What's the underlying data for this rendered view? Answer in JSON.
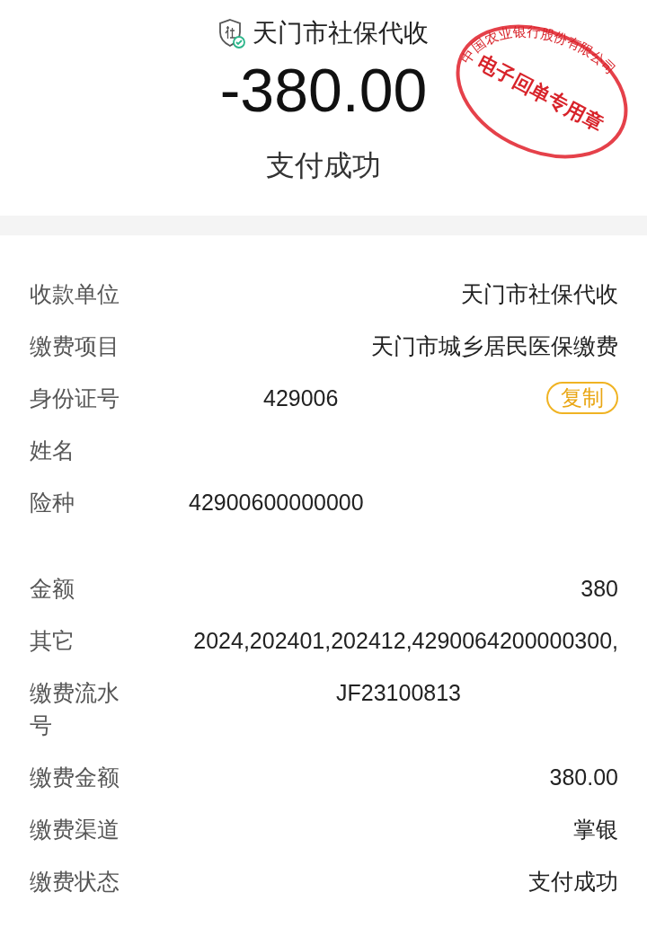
{
  "header": {
    "payee": "天门市社保代收",
    "amount": "-380.00",
    "status": "支付成功"
  },
  "stamp": {
    "ring_text": "中国农业银行股份有限公司",
    "center_text": "电子回单专用章"
  },
  "details": [
    {
      "label": "收款单位",
      "value": "天门市社保代收",
      "kind": "plain"
    },
    {
      "label": "缴费项目",
      "value": "天门市城乡居民医保缴费",
      "kind": "plain"
    },
    {
      "label": "身份证号",
      "value": "429006",
      "kind": "copy",
      "button": "复制"
    },
    {
      "label": "姓名",
      "kind": "plain"
    },
    {
      "label": "险种",
      "value": "42900600000000",
      "kind": "plain"
    },
    {
      "label": "金额",
      "value": "380",
      "kind": "plain"
    },
    {
      "label": "其它",
      "value": "2024,202401,202412,4290064200000300,",
      "kind": "plain"
    },
    {
      "label": "缴费流水号",
      "value": "JF23100813",
      "kind": "plain"
    },
    {
      "label": "缴费金额",
      "value": "380.00",
      "kind": "plain"
    },
    {
      "label": "缴费渠道",
      "value": "掌银",
      "kind": "plain"
    },
    {
      "label": "缴费状态",
      "value": "支付成功",
      "kind": "plain"
    }
  ]
}
